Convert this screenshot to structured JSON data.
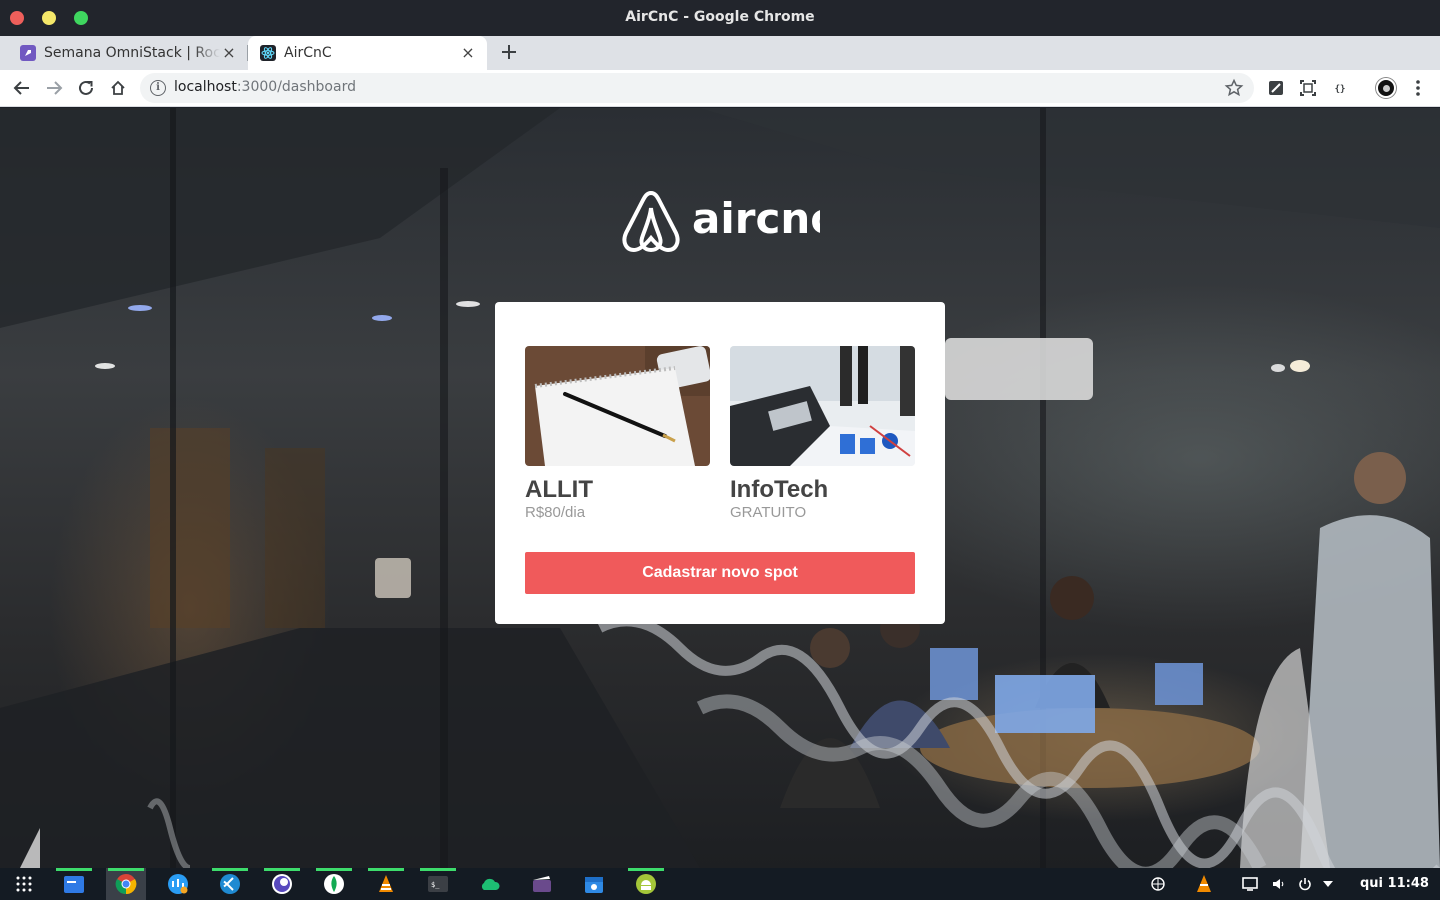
{
  "window": {
    "title": "AirCnC - Google Chrome"
  },
  "tabs": [
    {
      "title": "Semana OmniStack | Rocketseat",
      "active": false
    },
    {
      "title": "AirCnC",
      "active": true
    }
  ],
  "address_bar": {
    "host": "localhost",
    "path": ":3000/dashboard"
  },
  "page": {
    "logo_text": "aircnc",
    "spots": [
      {
        "company": "ALLIT",
        "price": "R$80/dia",
        "image": "notebook-with-pen-photo"
      },
      {
        "company": "InfoTech",
        "price": "GRATUITO",
        "image": "laptop-office-charts-photo"
      }
    ],
    "cta_label": "Cadastrar novo spot"
  },
  "taskbar": {
    "apps": [
      "apps-grid-icon",
      "file-manager-icon",
      "chrome-icon",
      "network-icon",
      "vscode-icon",
      "insomnia-icon",
      "mongodb-icon",
      "vlc-icon",
      "terminal-icon",
      "cloud-icon",
      "clapper-icon",
      "calendar-icon",
      "android-icon"
    ],
    "tray": [
      "globe-icon",
      "vlc-tray-icon",
      "screen-icon",
      "volume-icon",
      "power-icon",
      "tray-menu-icon"
    ],
    "clock": "qui 11:48"
  },
  "colors": {
    "accent": "#f05a5b",
    "taskbar_indicator": "#3ddc6c",
    "titlebar": "#22252c"
  }
}
